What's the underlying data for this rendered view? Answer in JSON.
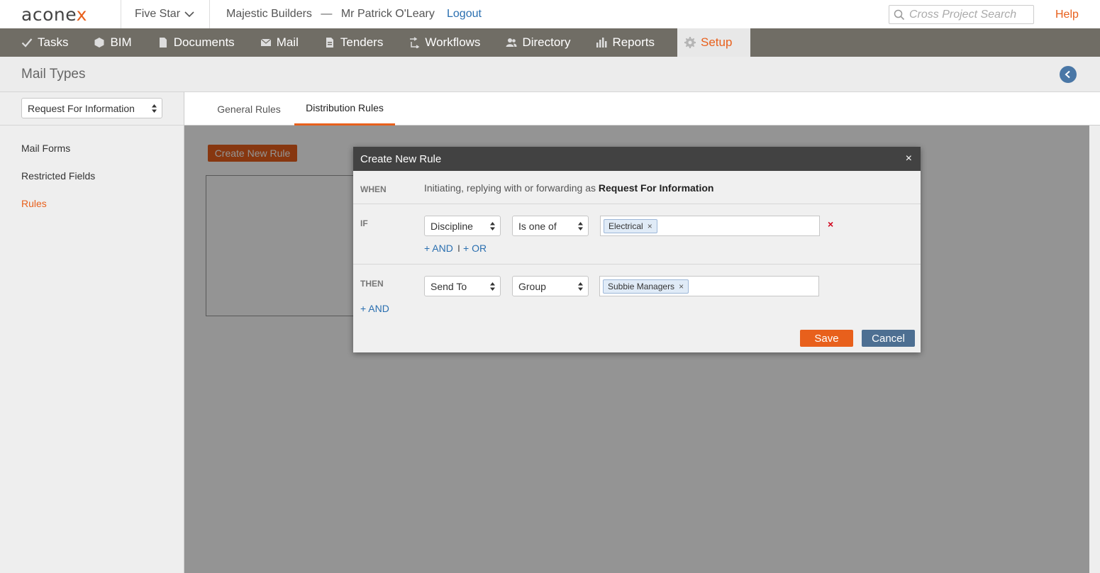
{
  "header": {
    "logo_main": "acone",
    "logo_accent": "x",
    "project": "Five Star",
    "organization": "Majestic Builders",
    "dash": "—",
    "user": "Mr Patrick O'Leary",
    "logout": "Logout",
    "search_placeholder": "Cross Project Search",
    "help": "Help"
  },
  "nav": {
    "items": [
      {
        "label": "Tasks",
        "icon": "check-icon"
      },
      {
        "label": "BIM",
        "icon": "cube-icon"
      },
      {
        "label": "Documents",
        "icon": "document-icon"
      },
      {
        "label": "Mail",
        "icon": "envelope-icon"
      },
      {
        "label": "Tenders",
        "icon": "tender-icon"
      },
      {
        "label": "Workflows",
        "icon": "workflow-icon"
      },
      {
        "label": "Directory",
        "icon": "people-icon"
      },
      {
        "label": "Reports",
        "icon": "bar-chart-icon"
      },
      {
        "label": "Setup",
        "icon": "gear-icon",
        "active": true
      }
    ]
  },
  "page": {
    "title": "Mail Types"
  },
  "sidebar": {
    "mail_type_select": "Request For Information",
    "links": [
      "Mail Forms",
      "Restricted Fields",
      "Rules"
    ],
    "active_link": "Rules"
  },
  "tabs": [
    "General Rules",
    "Distribution Rules"
  ],
  "active_tab": "Distribution Rules",
  "content": {
    "create_rule_button": "Create New Rule"
  },
  "modal": {
    "title": "Create New Rule",
    "close": "×",
    "when_label": "WHEN",
    "when_text": "Initiating, replying with or forwarding as",
    "when_value": "Request For Information",
    "if_label": "IF",
    "if_field": "Discipline",
    "if_operator": "Is one of",
    "if_tag": "Electrical",
    "add_and": "+ AND",
    "separator": "I",
    "add_or": "+ OR",
    "then_label": "THEN",
    "then_action": "Send To",
    "then_target_type": "Group",
    "then_tag": "Subbie Managers",
    "then_add_and": "+ AND",
    "tag_remove": "×",
    "condition_remove": "×",
    "save": "Save",
    "cancel": "Cancel"
  },
  "colors": {
    "accent": "#e8601c",
    "nav_bg": "#706d65",
    "link": "#2a6fb0",
    "cancel_button": "#4d6f92"
  }
}
